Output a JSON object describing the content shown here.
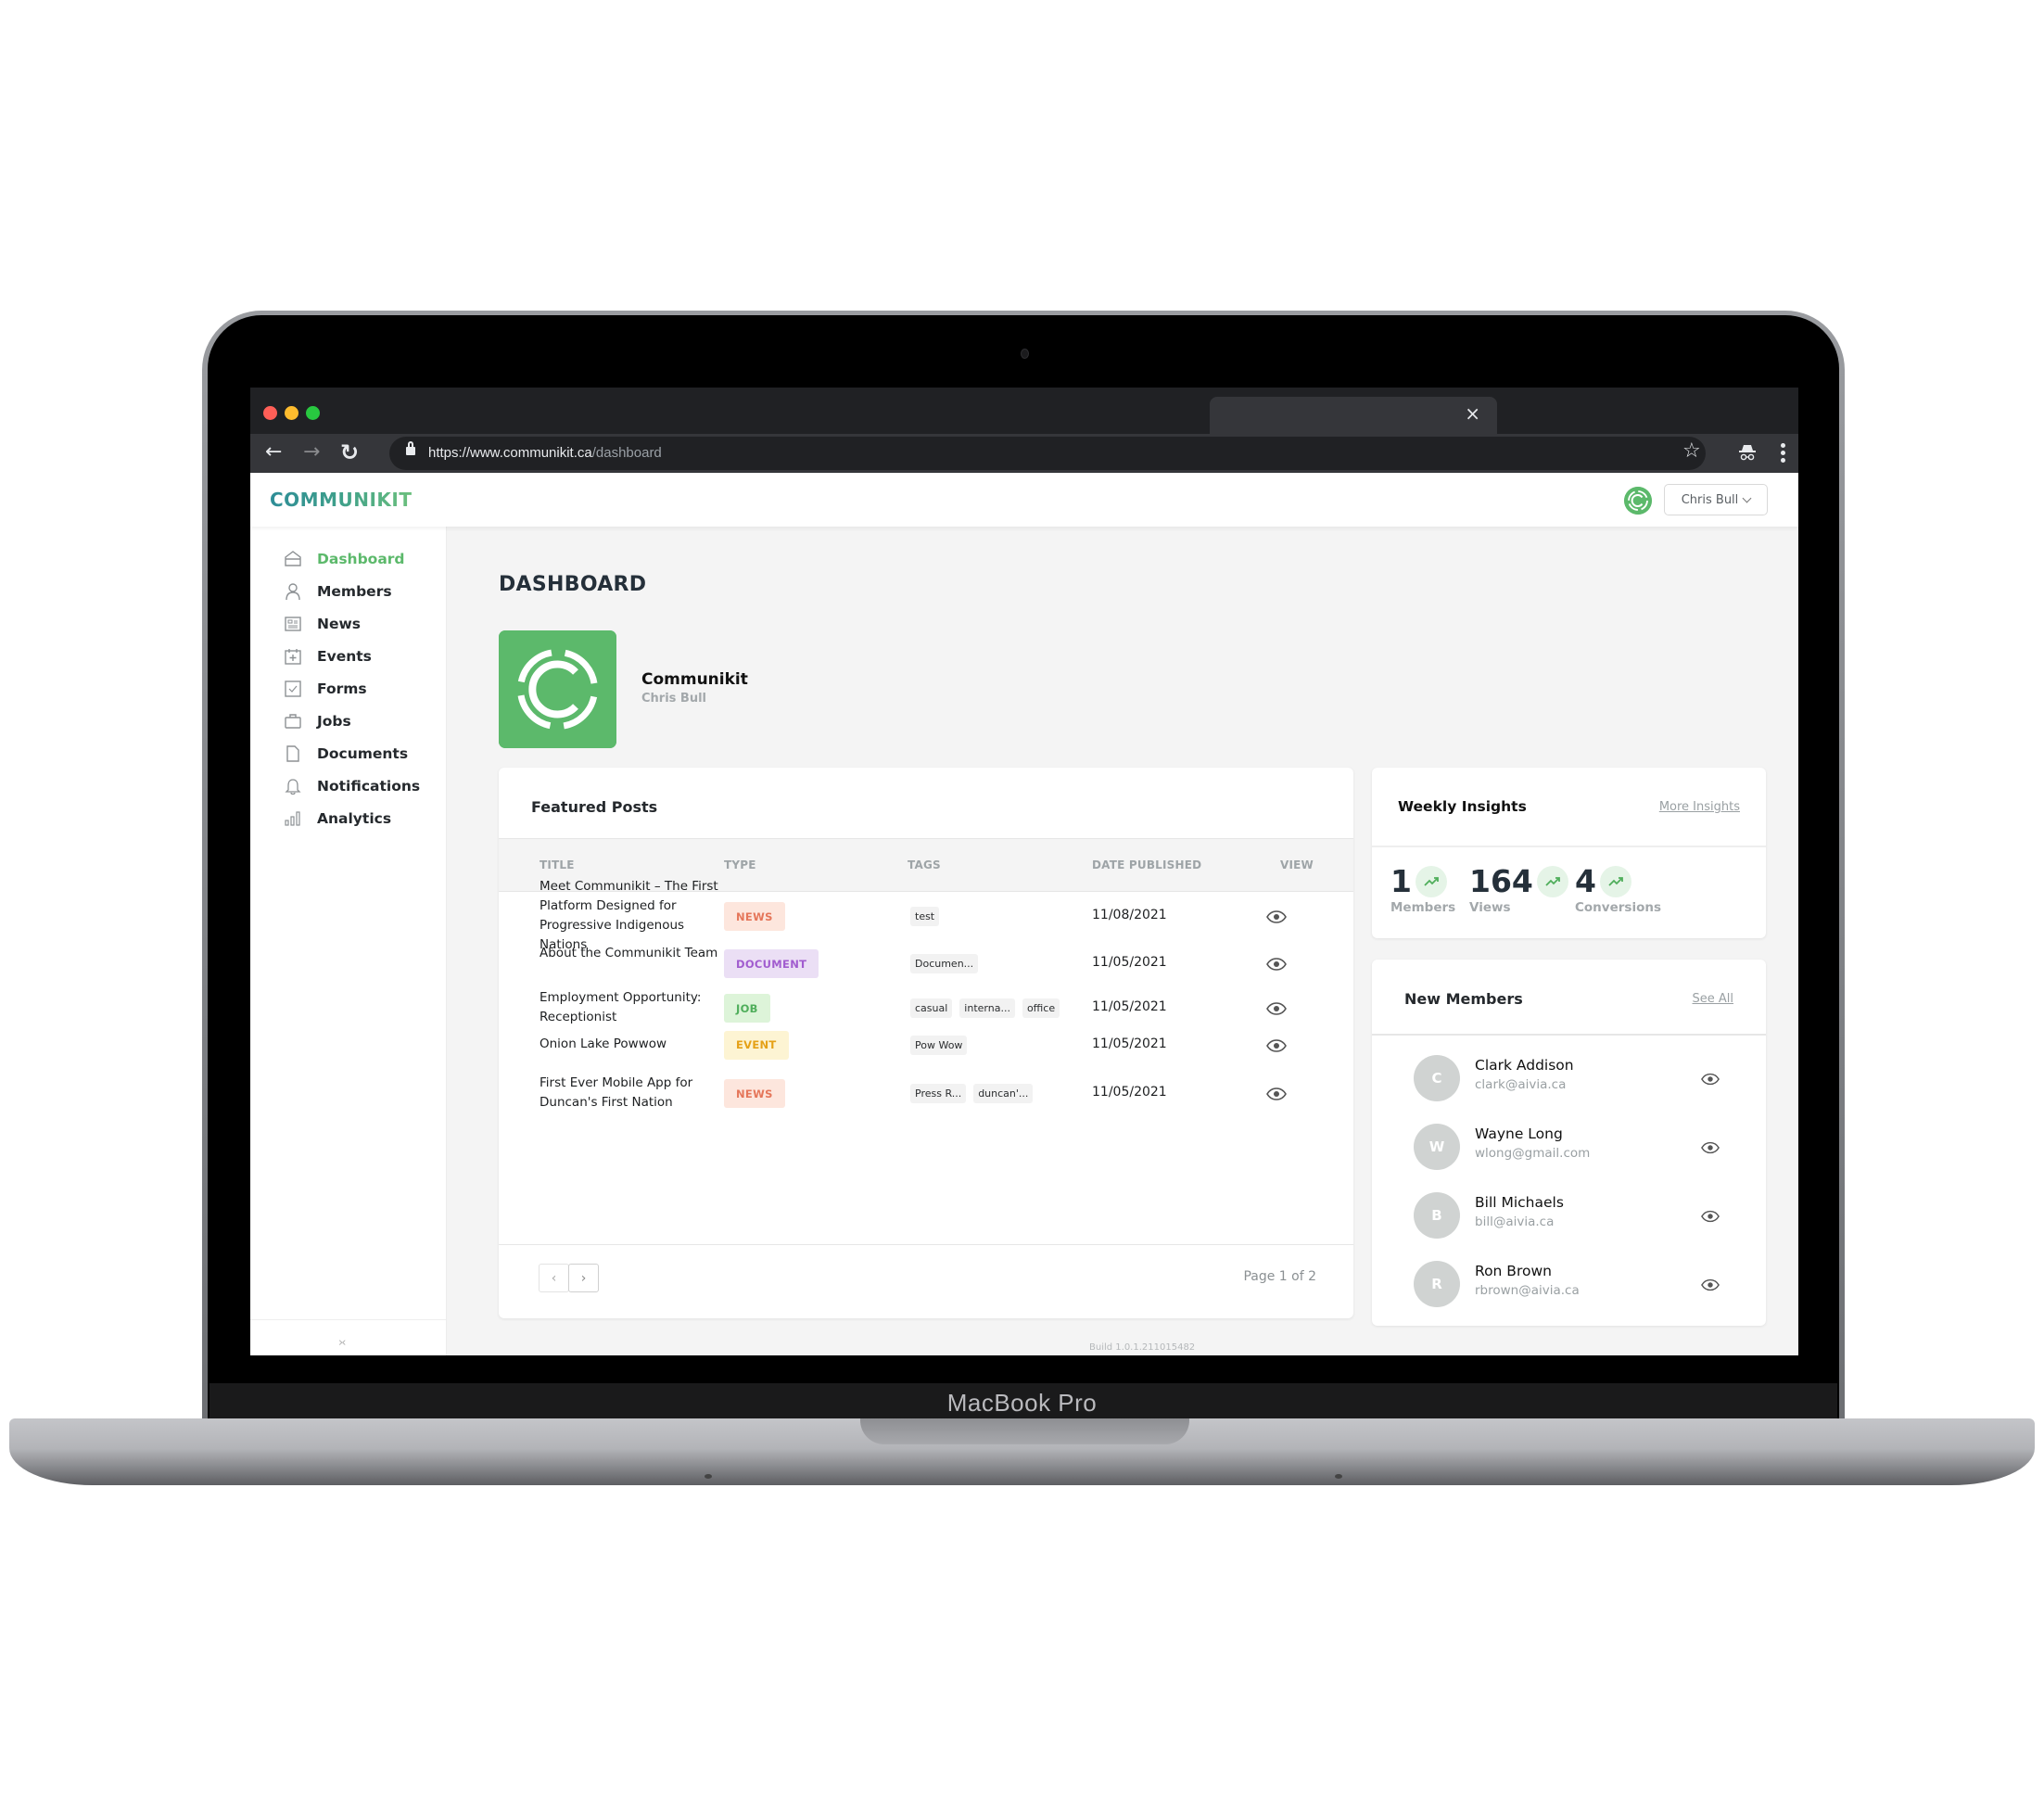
{
  "device": {
    "label": "MacBook Pro"
  },
  "browser": {
    "url_host": "https://www.communikit.ca",
    "url_path": "/dashboard",
    "tab_close": "×",
    "back_icon": "←",
    "forward_icon": "→",
    "reload_icon": "↻",
    "star_icon": "☆"
  },
  "header": {
    "brand": "COMMUNIKIT",
    "user_name": "Chris Bull"
  },
  "sidebar": {
    "items": [
      {
        "label": "Dashboard",
        "icon": "home-icon",
        "active": true
      },
      {
        "label": "Members",
        "icon": "user-icon"
      },
      {
        "label": "News",
        "icon": "newspaper-icon"
      },
      {
        "label": "Events",
        "icon": "calendar-plus-icon"
      },
      {
        "label": "Forms",
        "icon": "checkbox-icon"
      },
      {
        "label": "Jobs",
        "icon": "briefcase-icon"
      },
      {
        "label": "Documents",
        "icon": "document-icon"
      },
      {
        "label": "Notifications",
        "icon": "bell-icon"
      },
      {
        "label": "Analytics",
        "icon": "bar-chart-icon"
      }
    ],
    "collapse_label": "›‹"
  },
  "main": {
    "title": "DASHBOARD",
    "org": {
      "name": "Communikit",
      "owner": "Chris Bull"
    },
    "featured_posts": {
      "title": "Featured Posts",
      "columns": [
        "TITLE",
        "TYPE",
        "TAGS",
        "DATE PUBLISHED",
        "VIEW"
      ],
      "rows": [
        {
          "title": "Meet Communikit – The First Platform Designed for Progressive Indigenous Nations",
          "type": "NEWS",
          "tags": [
            "test"
          ],
          "date": "11/08/2021"
        },
        {
          "title": "About the Communikit Team",
          "type": "DOCUMENT",
          "tags": [
            "Documen..."
          ],
          "date": "11/05/2021"
        },
        {
          "title": "Employment Opportunity: Receptionist",
          "type": "JOB",
          "tags": [
            "casual",
            "interna...",
            "office"
          ],
          "date": "11/05/2021"
        },
        {
          "title": "Onion Lake Powwow",
          "type": "EVENT",
          "tags": [
            "Pow Wow"
          ],
          "date": "11/05/2021"
        },
        {
          "title": "First Ever Mobile App for Duncan's First Nation",
          "type": "NEWS",
          "tags": [
            "Press R...",
            "duncan'..."
          ],
          "date": "11/05/2021"
        }
      ],
      "pagination": {
        "prev": "‹",
        "next": "›",
        "page_info": "Page 1 of 2"
      }
    },
    "weekly_insights": {
      "title": "Weekly Insights",
      "link": "More Insights",
      "stats": [
        {
          "value": "1",
          "label": "Members"
        },
        {
          "value": "164",
          "label": "Views"
        },
        {
          "value": "4",
          "label": "Conversions"
        }
      ]
    },
    "new_members": {
      "title": "New Members",
      "link": "See All",
      "members": [
        {
          "initial": "C",
          "name": "Clark Addison",
          "email": "clark@aivia.ca"
        },
        {
          "initial": "W",
          "name": "Wayne Long",
          "email": "wlong@gmail.com"
        },
        {
          "initial": "B",
          "name": "Bill Michaels",
          "email": "bill@aivia.ca"
        },
        {
          "initial": "R",
          "name": "Ron Brown",
          "email": "rbrown@aivia.ca"
        }
      ]
    },
    "build": "Build 1.0.1.211015482"
  },
  "colors": {
    "accent": "#5cb96b",
    "type_badges": {
      "NEWS": {
        "bg": "#fde6dd",
        "fg": "#e5765a"
      },
      "DOCUMENT": {
        "bg": "#ebdff5",
        "fg": "#a15ccf"
      },
      "JOB": {
        "bg": "#ddf4d9",
        "fg": "#4fae5b"
      },
      "EVENT": {
        "bg": "#fdf4d3",
        "fg": "#e5a117"
      }
    }
  }
}
